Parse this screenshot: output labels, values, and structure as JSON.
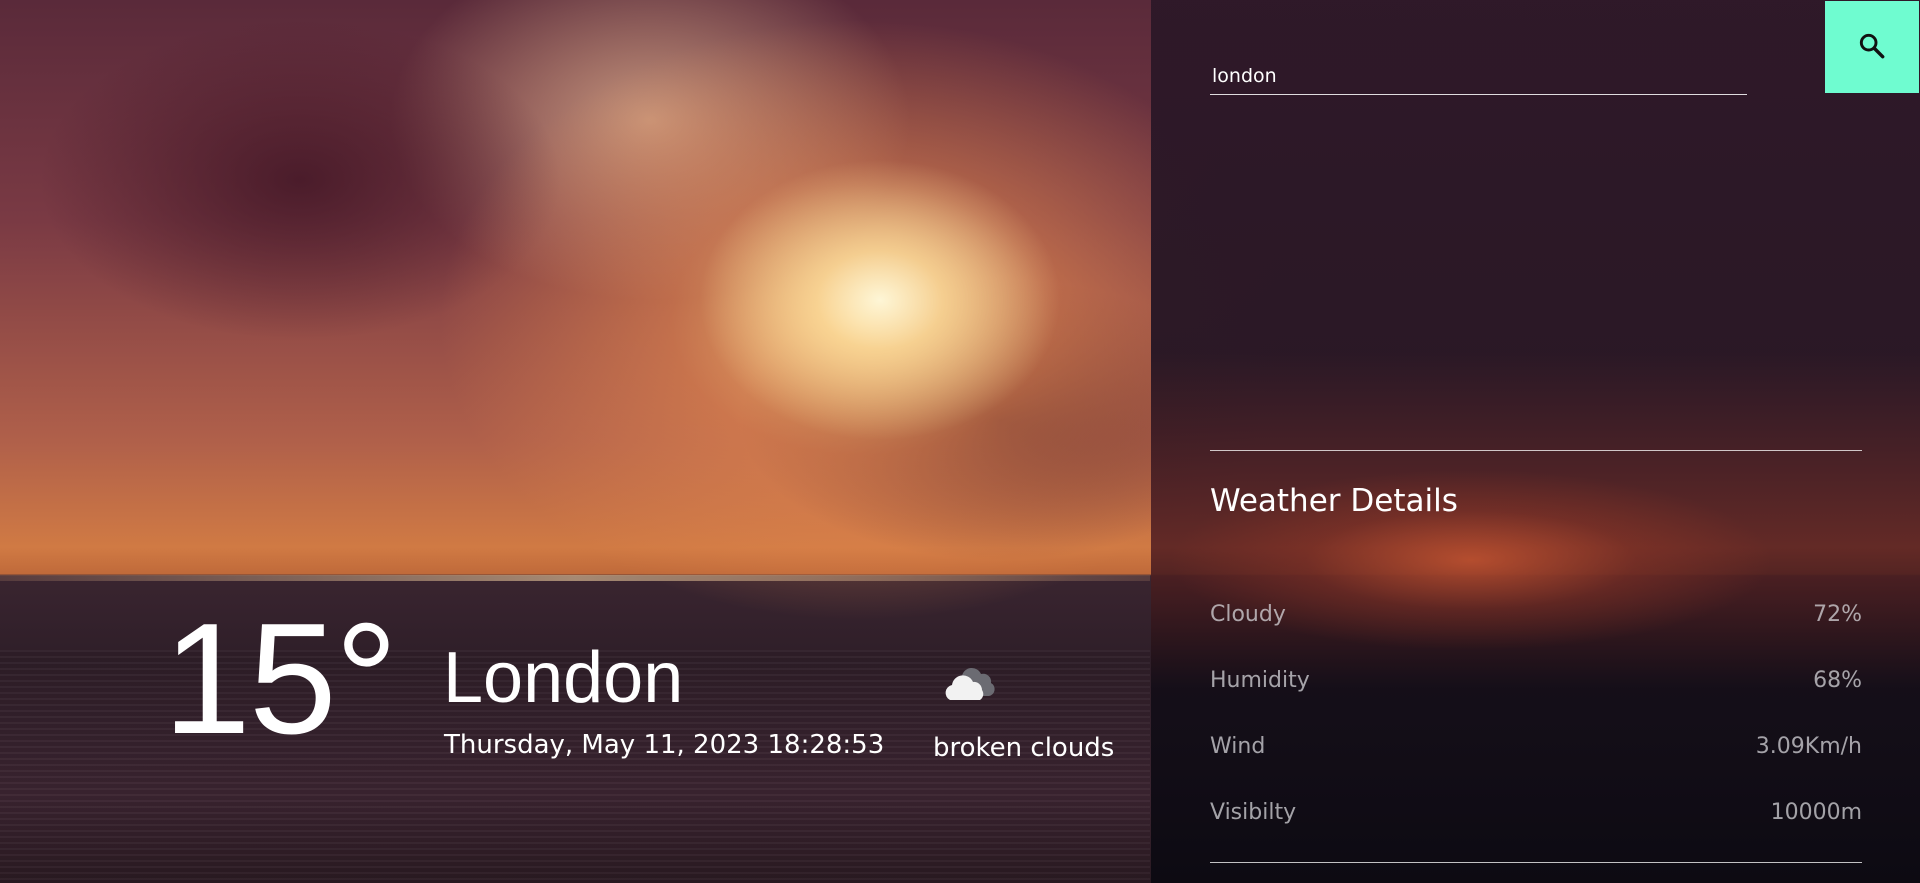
{
  "search": {
    "value": "london",
    "placeholder": ""
  },
  "icons": {
    "search": "search-icon",
    "condition": "cloud-icon"
  },
  "colors": {
    "search_button": "#6ffcd0",
    "text_primary": "#ffffff",
    "text_muted": "#c9c7cc"
  },
  "current": {
    "temperature": "15°",
    "city": "London",
    "datetime": "Thursday, May 11, 2023 18:28:53",
    "condition": "broken clouds"
  },
  "details": {
    "title": "Weather Details",
    "rows": [
      {
        "label": "Cloudy",
        "value": "72%"
      },
      {
        "label": "Humidity",
        "value": "68%"
      },
      {
        "label": "Wind",
        "value": "3.09Km/h"
      },
      {
        "label": "Visibilty",
        "value": "10000m"
      }
    ]
  }
}
